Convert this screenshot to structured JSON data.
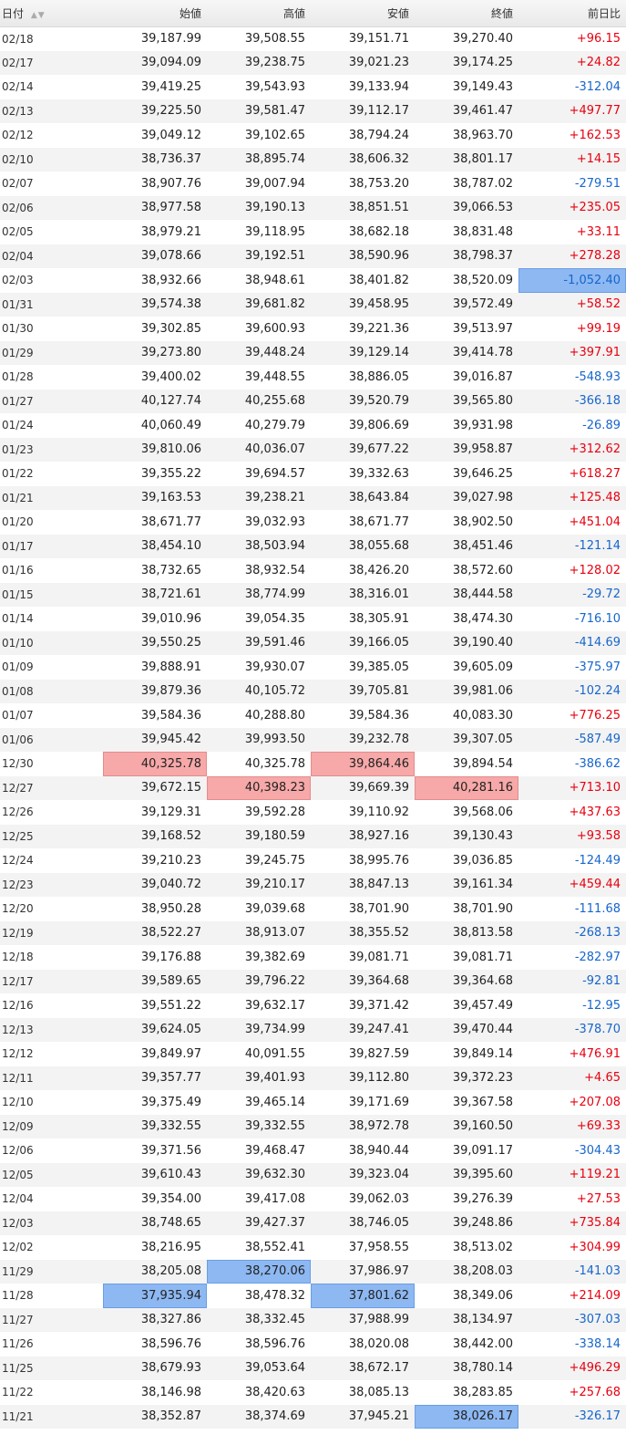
{
  "headers": {
    "date": "日付",
    "open": "始値",
    "high": "高値",
    "low": "安値",
    "close": "終値",
    "change": "前日比"
  },
  "sort_icon": "sort-up-down-icon",
  "colors": {
    "up": "#e8000f",
    "down": "#1766cc",
    "highlight_high": "#f7a8a8",
    "highlight_low": "#8db8f2"
  },
  "rows": [
    {
      "date": "02/18",
      "open": "39,187.99",
      "high": "39,508.55",
      "low": "39,151.71",
      "close": "39,270.40",
      "change": "+96.15",
      "dir": "up",
      "hl": {}
    },
    {
      "date": "02/17",
      "open": "39,094.09",
      "high": "39,238.75",
      "low": "39,021.23",
      "close": "39,174.25",
      "change": "+24.82",
      "dir": "up",
      "hl": {}
    },
    {
      "date": "02/14",
      "open": "39,419.25",
      "high": "39,543.93",
      "low": "39,133.94",
      "close": "39,149.43",
      "change": "-312.04",
      "dir": "down",
      "hl": {}
    },
    {
      "date": "02/13",
      "open": "39,225.50",
      "high": "39,581.47",
      "low": "39,112.17",
      "close": "39,461.47",
      "change": "+497.77",
      "dir": "up",
      "hl": {}
    },
    {
      "date": "02/12",
      "open": "39,049.12",
      "high": "39,102.65",
      "low": "38,794.24",
      "close": "38,963.70",
      "change": "+162.53",
      "dir": "up",
      "hl": {}
    },
    {
      "date": "02/10",
      "open": "38,736.37",
      "high": "38,895.74",
      "low": "38,606.32",
      "close": "38,801.17",
      "change": "+14.15",
      "dir": "up",
      "hl": {}
    },
    {
      "date": "02/07",
      "open": "38,907.76",
      "high": "39,007.94",
      "low": "38,753.20",
      "close": "38,787.02",
      "change": "-279.51",
      "dir": "down",
      "hl": {}
    },
    {
      "date": "02/06",
      "open": "38,977.58",
      "high": "39,190.13",
      "low": "38,851.51",
      "close": "39,066.53",
      "change": "+235.05",
      "dir": "up",
      "hl": {}
    },
    {
      "date": "02/05",
      "open": "38,979.21",
      "high": "39,118.95",
      "low": "38,682.18",
      "close": "38,831.48",
      "change": "+33.11",
      "dir": "up",
      "hl": {}
    },
    {
      "date": "02/04",
      "open": "39,078.66",
      "high": "39,192.51",
      "low": "38,590.96",
      "close": "38,798.37",
      "change": "+278.28",
      "dir": "up",
      "hl": {}
    },
    {
      "date": "02/03",
      "open": "38,932.66",
      "high": "38,948.61",
      "low": "38,401.82",
      "close": "38,520.09",
      "change": "-1,052.40",
      "dir": "down",
      "hl": {
        "change": "low"
      }
    },
    {
      "date": "01/31",
      "open": "39,574.38",
      "high": "39,681.82",
      "low": "39,458.95",
      "close": "39,572.49",
      "change": "+58.52",
      "dir": "up",
      "hl": {}
    },
    {
      "date": "01/30",
      "open": "39,302.85",
      "high": "39,600.93",
      "low": "39,221.36",
      "close": "39,513.97",
      "change": "+99.19",
      "dir": "up",
      "hl": {}
    },
    {
      "date": "01/29",
      "open": "39,273.80",
      "high": "39,448.24",
      "low": "39,129.14",
      "close": "39,414.78",
      "change": "+397.91",
      "dir": "up",
      "hl": {}
    },
    {
      "date": "01/28",
      "open": "39,400.02",
      "high": "39,448.55",
      "low": "38,886.05",
      "close": "39,016.87",
      "change": "-548.93",
      "dir": "down",
      "hl": {}
    },
    {
      "date": "01/27",
      "open": "40,127.74",
      "high": "40,255.68",
      "low": "39,520.79",
      "close": "39,565.80",
      "change": "-366.18",
      "dir": "down",
      "hl": {}
    },
    {
      "date": "01/24",
      "open": "40,060.49",
      "high": "40,279.79",
      "low": "39,806.69",
      "close": "39,931.98",
      "change": "-26.89",
      "dir": "down",
      "hl": {}
    },
    {
      "date": "01/23",
      "open": "39,810.06",
      "high": "40,036.07",
      "low": "39,677.22",
      "close": "39,958.87",
      "change": "+312.62",
      "dir": "up",
      "hl": {}
    },
    {
      "date": "01/22",
      "open": "39,355.22",
      "high": "39,694.57",
      "low": "39,332.63",
      "close": "39,646.25",
      "change": "+618.27",
      "dir": "up",
      "hl": {}
    },
    {
      "date": "01/21",
      "open": "39,163.53",
      "high": "39,238.21",
      "low": "38,643.84",
      "close": "39,027.98",
      "change": "+125.48",
      "dir": "up",
      "hl": {}
    },
    {
      "date": "01/20",
      "open": "38,671.77",
      "high": "39,032.93",
      "low": "38,671.77",
      "close": "38,902.50",
      "change": "+451.04",
      "dir": "up",
      "hl": {}
    },
    {
      "date": "01/17",
      "open": "38,454.10",
      "high": "38,503.94",
      "low": "38,055.68",
      "close": "38,451.46",
      "change": "-121.14",
      "dir": "down",
      "hl": {}
    },
    {
      "date": "01/16",
      "open": "38,732.65",
      "high": "38,932.54",
      "low": "38,426.20",
      "close": "38,572.60",
      "change": "+128.02",
      "dir": "up",
      "hl": {}
    },
    {
      "date": "01/15",
      "open": "38,721.61",
      "high": "38,774.99",
      "low": "38,316.01",
      "close": "38,444.58",
      "change": "-29.72",
      "dir": "down",
      "hl": {}
    },
    {
      "date": "01/14",
      "open": "39,010.96",
      "high": "39,054.35",
      "low": "38,305.91",
      "close": "38,474.30",
      "change": "-716.10",
      "dir": "down",
      "hl": {}
    },
    {
      "date": "01/10",
      "open": "39,550.25",
      "high": "39,591.46",
      "low": "39,166.05",
      "close": "39,190.40",
      "change": "-414.69",
      "dir": "down",
      "hl": {}
    },
    {
      "date": "01/09",
      "open": "39,888.91",
      "high": "39,930.07",
      "low": "39,385.05",
      "close": "39,605.09",
      "change": "-375.97",
      "dir": "down",
      "hl": {}
    },
    {
      "date": "01/08",
      "open": "39,879.36",
      "high": "40,105.72",
      "low": "39,705.81",
      "close": "39,981.06",
      "change": "-102.24",
      "dir": "down",
      "hl": {}
    },
    {
      "date": "01/07",
      "open": "39,584.36",
      "high": "40,288.80",
      "low": "39,584.36",
      "close": "40,083.30",
      "change": "+776.25",
      "dir": "up",
      "hl": {}
    },
    {
      "date": "01/06",
      "open": "39,945.42",
      "high": "39,993.50",
      "low": "39,232.78",
      "close": "39,307.05",
      "change": "-587.49",
      "dir": "down",
      "hl": {}
    },
    {
      "date": "12/30",
      "open": "40,325.78",
      "high": "40,325.78",
      "low": "39,864.46",
      "close": "39,894.54",
      "change": "-386.62",
      "dir": "down",
      "hl": {
        "open": "high",
        "low": "high"
      }
    },
    {
      "date": "12/27",
      "open": "39,672.15",
      "high": "40,398.23",
      "low": "39,669.39",
      "close": "40,281.16",
      "change": "+713.10",
      "dir": "up",
      "hl": {
        "high": "high",
        "close": "high"
      }
    },
    {
      "date": "12/26",
      "open": "39,129.31",
      "high": "39,592.28",
      "low": "39,110.92",
      "close": "39,568.06",
      "change": "+437.63",
      "dir": "up",
      "hl": {}
    },
    {
      "date": "12/25",
      "open": "39,168.52",
      "high": "39,180.59",
      "low": "38,927.16",
      "close": "39,130.43",
      "change": "+93.58",
      "dir": "up",
      "hl": {}
    },
    {
      "date": "12/24",
      "open": "39,210.23",
      "high": "39,245.75",
      "low": "38,995.76",
      "close": "39,036.85",
      "change": "-124.49",
      "dir": "down",
      "hl": {}
    },
    {
      "date": "12/23",
      "open": "39,040.72",
      "high": "39,210.17",
      "low": "38,847.13",
      "close": "39,161.34",
      "change": "+459.44",
      "dir": "up",
      "hl": {}
    },
    {
      "date": "12/20",
      "open": "38,950.28",
      "high": "39,039.68",
      "low": "38,701.90",
      "close": "38,701.90",
      "change": "-111.68",
      "dir": "down",
      "hl": {}
    },
    {
      "date": "12/19",
      "open": "38,522.27",
      "high": "38,913.07",
      "low": "38,355.52",
      "close": "38,813.58",
      "change": "-268.13",
      "dir": "down",
      "hl": {}
    },
    {
      "date": "12/18",
      "open": "39,176.88",
      "high": "39,382.69",
      "low": "39,081.71",
      "close": "39,081.71",
      "change": "-282.97",
      "dir": "down",
      "hl": {}
    },
    {
      "date": "12/17",
      "open": "39,589.65",
      "high": "39,796.22",
      "low": "39,364.68",
      "close": "39,364.68",
      "change": "-92.81",
      "dir": "down",
      "hl": {}
    },
    {
      "date": "12/16",
      "open": "39,551.22",
      "high": "39,632.17",
      "low": "39,371.42",
      "close": "39,457.49",
      "change": "-12.95",
      "dir": "down",
      "hl": {}
    },
    {
      "date": "12/13",
      "open": "39,624.05",
      "high": "39,734.99",
      "low": "39,247.41",
      "close": "39,470.44",
      "change": "-378.70",
      "dir": "down",
      "hl": {}
    },
    {
      "date": "12/12",
      "open": "39,849.97",
      "high": "40,091.55",
      "low": "39,827.59",
      "close": "39,849.14",
      "change": "+476.91",
      "dir": "up",
      "hl": {}
    },
    {
      "date": "12/11",
      "open": "39,357.77",
      "high": "39,401.93",
      "low": "39,112.80",
      "close": "39,372.23",
      "change": "+4.65",
      "dir": "up",
      "hl": {}
    },
    {
      "date": "12/10",
      "open": "39,375.49",
      "high": "39,465.14",
      "low": "39,171.69",
      "close": "39,367.58",
      "change": "+207.08",
      "dir": "up",
      "hl": {}
    },
    {
      "date": "12/09",
      "open": "39,332.55",
      "high": "39,332.55",
      "low": "38,972.78",
      "close": "39,160.50",
      "change": "+69.33",
      "dir": "up",
      "hl": {}
    },
    {
      "date": "12/06",
      "open": "39,371.56",
      "high": "39,468.47",
      "low": "38,940.44",
      "close": "39,091.17",
      "change": "-304.43",
      "dir": "down",
      "hl": {}
    },
    {
      "date": "12/05",
      "open": "39,610.43",
      "high": "39,632.30",
      "low": "39,323.04",
      "close": "39,395.60",
      "change": "+119.21",
      "dir": "up",
      "hl": {}
    },
    {
      "date": "12/04",
      "open": "39,354.00",
      "high": "39,417.08",
      "low": "39,062.03",
      "close": "39,276.39",
      "change": "+27.53",
      "dir": "up",
      "hl": {}
    },
    {
      "date": "12/03",
      "open": "38,748.65",
      "high": "39,427.37",
      "low": "38,746.05",
      "close": "39,248.86",
      "change": "+735.84",
      "dir": "up",
      "hl": {}
    },
    {
      "date": "12/02",
      "open": "38,216.95",
      "high": "38,552.41",
      "low": "37,958.55",
      "close": "38,513.02",
      "change": "+304.99",
      "dir": "up",
      "hl": {}
    },
    {
      "date": "11/29",
      "open": "38,205.08",
      "high": "38,270.06",
      "low": "37,986.97",
      "close": "38,208.03",
      "change": "-141.03",
      "dir": "down",
      "hl": {
        "high": "low"
      }
    },
    {
      "date": "11/28",
      "open": "37,935.94",
      "high": "38,478.32",
      "low": "37,801.62",
      "close": "38,349.06",
      "change": "+214.09",
      "dir": "up",
      "hl": {
        "open": "low",
        "low": "low"
      }
    },
    {
      "date": "11/27",
      "open": "38,327.86",
      "high": "38,332.45",
      "low": "37,988.99",
      "close": "38,134.97",
      "change": "-307.03",
      "dir": "down",
      "hl": {}
    },
    {
      "date": "11/26",
      "open": "38,596.76",
      "high": "38,596.76",
      "low": "38,020.08",
      "close": "38,442.00",
      "change": "-338.14",
      "dir": "down",
      "hl": {}
    },
    {
      "date": "11/25",
      "open": "38,679.93",
      "high": "39,053.64",
      "low": "38,672.17",
      "close": "38,780.14",
      "change": "+496.29",
      "dir": "up",
      "hl": {}
    },
    {
      "date": "11/22",
      "open": "38,146.98",
      "high": "38,420.63",
      "low": "38,085.13",
      "close": "38,283.85",
      "change": "+257.68",
      "dir": "up",
      "hl": {}
    },
    {
      "date": "11/21",
      "open": "38,352.87",
      "high": "38,374.69",
      "low": "37,945.21",
      "close": "38,026.17",
      "change": "-326.17",
      "dir": "down",
      "hl": {
        "close": "low"
      }
    }
  ]
}
